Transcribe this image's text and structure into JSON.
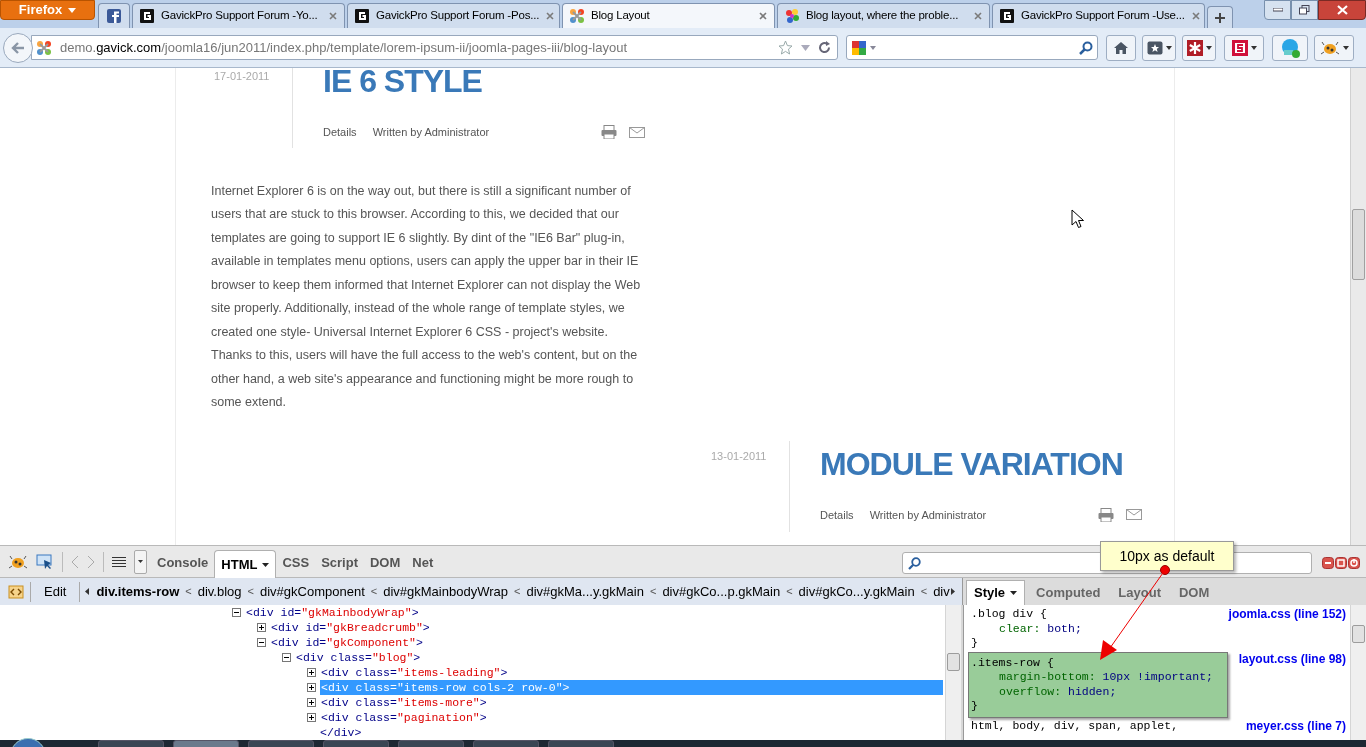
{
  "browser": {
    "menu_button": "Firefox",
    "tabs": [
      {
        "selected": false
      },
      {
        "title": "GavickPro Support Forum -Yo...",
        "selected": false
      },
      {
        "title": "GavickPro Support Forum -Pos...",
        "selected": false
      },
      {
        "title": "Blog Layout",
        "selected": true
      },
      {
        "title": "Blog layout, where the proble...",
        "selected": false
      },
      {
        "title": "GavickPro Support Forum -Use...",
        "selected": false
      }
    ],
    "address": {
      "subdomain": "demo.",
      "domain": "gavick.com",
      "path": "/joomla16/jun2011/index.php/template/lorem-ipsum-ii/joomla-pages-iii/blog-layout"
    }
  },
  "articles": [
    {
      "date": "17-01-2011",
      "title": "IE 6 STYLE",
      "meta": [
        "Details",
        "Written by Administrator"
      ],
      "body": "Internet Explorer 6 is on the way out, but there is still a significant number of users that are stuck to this browser. According to this, we decided that our templates are going to support IE 6 slightly. By dint of the \"IE6 Bar\" plug-in, available in templates menu options, users can apply the upper bar in their IE browser to keep them informed that Internet Explorer can not display the Web site properly. Additionally, instead of the whole range of template styles, we created one style- Universal Internet Explorer 6 CSS - project's website. Thanks to this, users will have the full access to the web's content, but on the other hand, a web site's appearance and functioning might be more rough to some extend."
    },
    {
      "date": "13-01-2011",
      "title": "MODULE VARIATION",
      "meta": [
        "Details",
        "Written by Administrator"
      ]
    }
  ],
  "firebug": {
    "tabs": [
      {
        "label": "Console",
        "selected": false
      },
      {
        "label": "HTML",
        "selected": true
      },
      {
        "label": "CSS",
        "selected": false
      },
      {
        "label": "Script",
        "selected": false
      },
      {
        "label": "DOM",
        "selected": false
      },
      {
        "label": "Net",
        "selected": false
      }
    ],
    "breadcrumb": {
      "edit": "Edit",
      "items": [
        {
          "label": "div.items-row",
          "selected": true
        },
        {
          "separator": "<",
          "label": "div.blog",
          "selected": false
        },
        {
          "separator": "<",
          "label": "div#gkComponent",
          "selected": false
        },
        {
          "separator": "<",
          "label": "div#gkMainbodyWrap",
          "selected": false
        },
        {
          "separator": "<",
          "label": "div#gkMa...y.gkMain",
          "selected": false
        },
        {
          "separator": "<",
          "label": "div#gkCo...p.gkMain",
          "selected": false
        },
        {
          "separator": "<",
          "label": "div#gkCo...y.gkMain",
          "selected": false
        },
        {
          "separator": "<",
          "label": "div",
          "selected": false
        }
      ]
    },
    "side_tabs": [
      {
        "label": "Style",
        "selected": true
      },
      {
        "label": "Computed",
        "selected": false
      },
      {
        "label": "Layout",
        "selected": false
      },
      {
        "label": "DOM",
        "selected": false
      }
    ],
    "tree": [
      {
        "kind": "element",
        "open": "<div",
        "attr": " id=",
        "value": "\"gkMainbodyWrap\"",
        "end": ">",
        "expanded": true,
        "selected": false,
        "children": [
          {
            "kind": "element",
            "open": "<div",
            "attr": " id=",
            "value": "\"gkBreadcrumb\"",
            "end": ">",
            "expanded": false,
            "selected": false
          },
          {
            "kind": "element",
            "open": "<div",
            "attr": " id=",
            "value": "\"gkComponent\"",
            "end": ">",
            "expanded": true,
            "selected": false,
            "children": [
              {
                "kind": "element",
                "open": "<div",
                "attr": " class=",
                "value": "\"blog\"",
                "end": ">",
                "expanded": true,
                "selected": false,
                "children": [
                  {
                    "kind": "element",
                    "open": "<div",
                    "attr": " class=",
                    "value": "\"items-leading\"",
                    "end": ">",
                    "expanded": false,
                    "selected": false
                  },
                  {
                    "kind": "element",
                    "open": "<div",
                    "attr": " class=",
                    "value": "\"items-row cols-2 row-0\"",
                    "end": ">",
                    "expanded": false,
                    "selected": true
                  },
                  {
                    "kind": "element",
                    "open": "<div",
                    "attr": " class=",
                    "value": "\"items-more\"",
                    "end": ">",
                    "expanded": false,
                    "selected": false
                  },
                  {
                    "kind": "element",
                    "open": "<div",
                    "attr": " class=",
                    "value": "\"pagination\"",
                    "end": ">",
                    "expanded": false,
                    "selected": false
                  },
                  {
                    "kind": "close",
                    "text": "</div>"
                  }
                ]
              }
            ]
          }
        ]
      }
    ],
    "rules": [
      {
        "selector": ".blog div {",
        "props": [
          {
            "name": "clear:",
            "value": "both;"
          }
        ],
        "close": "}",
        "source": "joomla.css (line 152)",
        "highlighted": false
      },
      {
        "selector": ".items-row {",
        "props": [
          {
            "name": "margin-bottom:",
            "value": "10px !important;"
          },
          {
            "name": "overflow:",
            "value": "hidden;"
          }
        ],
        "close": "}",
        "source": "layout.css (line 98)",
        "highlighted": true
      },
      {
        "selector": "html, body, div, span, applet,",
        "source": "meyer.css (line 7)",
        "highlighted": false
      }
    ]
  },
  "annotation": {
    "text": "10px as default"
  }
}
